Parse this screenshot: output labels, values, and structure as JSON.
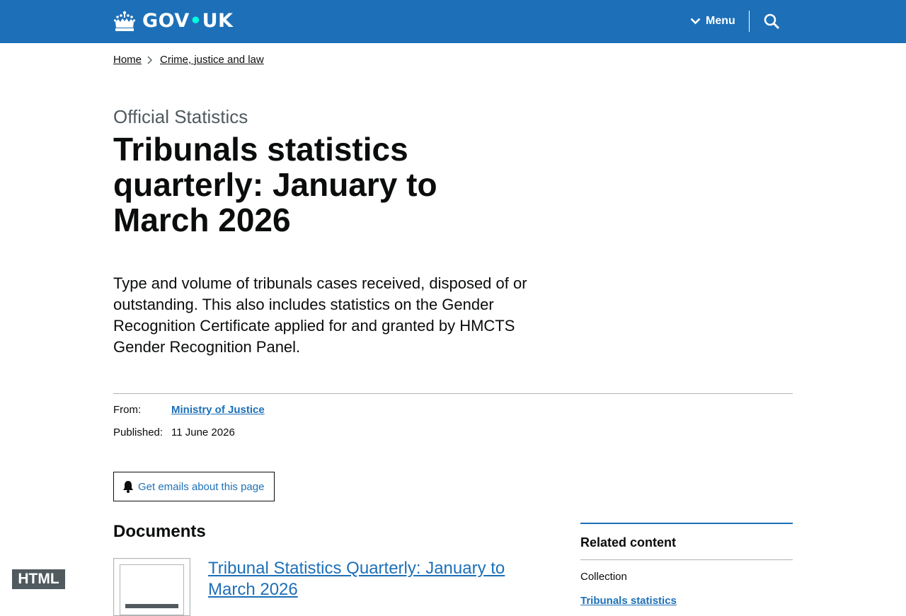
{
  "header": {
    "logo_text_left": "GOV",
    "logo_dot": "•",
    "logo_text_right": "UK",
    "menu_label": "Menu",
    "search_icon": "search-icon",
    "crown_icon": "crown-icon",
    "brand_color": "#1d70b8"
  },
  "breadcrumb": {
    "items": [
      "Home",
      "Crime, justice and law"
    ]
  },
  "page": {
    "caption": "Official Statistics",
    "title": "Tribunals statistics quarterly: January to March 2026",
    "lead": "Type and volume of tribunals cases received, disposed of or outstanding. This also includes statistics on the Gender Recognition Certificate applied for and granted by HMCTS Gender Recognition Panel."
  },
  "metadata": {
    "from_label": "From:",
    "from_value": "Ministry of Justice",
    "published_label": "Published:",
    "published_value": "11 June 2026"
  },
  "email_button": {
    "label": "Get emails about this page",
    "icon": "bell-icon"
  },
  "documents": {
    "heading": "Documents",
    "items": [
      {
        "thumbnail_label": "HTML",
        "title": "Tribunal Statistics Quarterly: January to March 2026"
      }
    ]
  },
  "related": {
    "heading": "Related content",
    "sub_label": "Collection",
    "link": "Tribunals statistics"
  }
}
